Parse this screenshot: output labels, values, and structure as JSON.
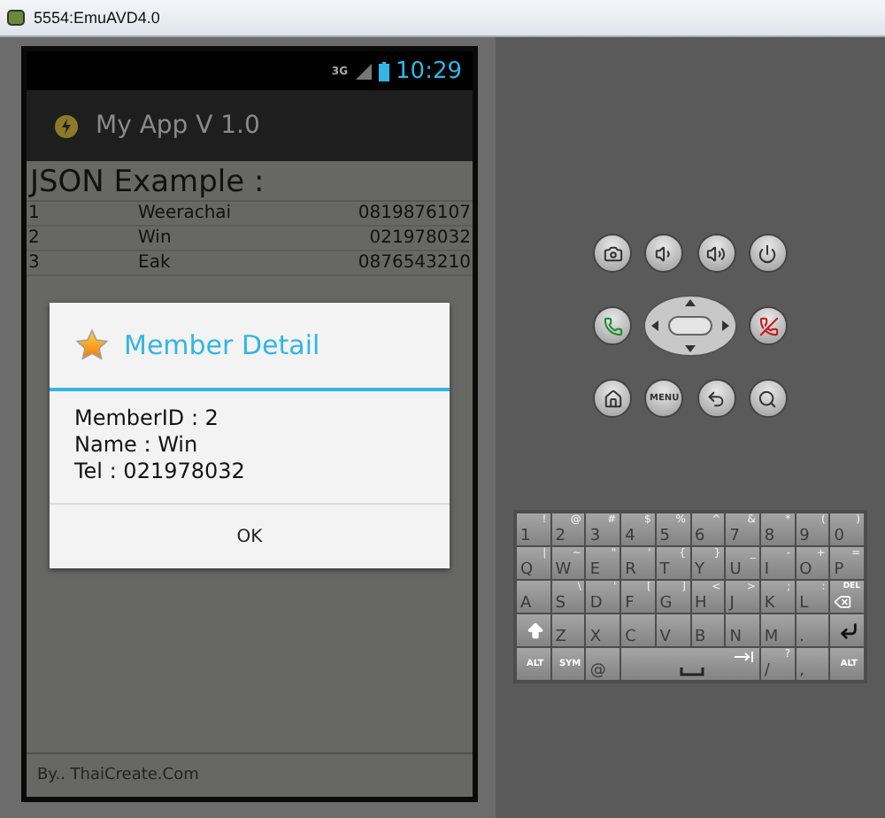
{
  "window": {
    "title": "5554:EmuAVD4.0"
  },
  "status_bar": {
    "network": "3G",
    "time": "10:29"
  },
  "action_bar": {
    "title": "My App V 1.0"
  },
  "heading": "JSON Example :",
  "rows": [
    {
      "id": "1",
      "name": "Weerachai",
      "tel": "0819876107"
    },
    {
      "id": "2",
      "name": "Win",
      "tel": "021978032"
    },
    {
      "id": "3",
      "name": "Eak",
      "tel": "0876543210"
    }
  ],
  "dialog": {
    "title": "Member Detail",
    "lines": [
      "MemberID : 2",
      "Name : Win",
      "Tel : 021978032"
    ],
    "button": "OK"
  },
  "footer": "By.. ThaiCreate.Com",
  "hardware_buttons": [
    [
      {
        "kind": "camera"
      },
      {
        "kind": "volume-down"
      },
      {
        "kind": "volume-up"
      },
      {
        "kind": "power"
      }
    ],
    [
      {
        "kind": "call"
      },
      {
        "kind": "dpad"
      },
      {
        "kind": "end-call"
      }
    ],
    [
      {
        "kind": "home"
      },
      {
        "kind": "menu",
        "label": "MENU"
      },
      {
        "kind": "back"
      },
      {
        "kind": "search"
      }
    ]
  ],
  "keyboard": [
    [
      {
        "kind": "char",
        "label": "1",
        "alt": "!"
      },
      {
        "kind": "char",
        "label": "2",
        "alt": "@"
      },
      {
        "kind": "char",
        "label": "3",
        "alt": "#"
      },
      {
        "kind": "char",
        "label": "4",
        "alt": "$"
      },
      {
        "kind": "char",
        "label": "5",
        "alt": "%"
      },
      {
        "kind": "char",
        "label": "6",
        "alt": "^"
      },
      {
        "kind": "char",
        "label": "7",
        "alt": "&"
      },
      {
        "kind": "char",
        "label": "8",
        "alt": "*"
      },
      {
        "kind": "char",
        "label": "9",
        "alt": "("
      },
      {
        "kind": "char",
        "label": "0",
        "alt": ")"
      }
    ],
    [
      {
        "kind": "char",
        "label": "Q",
        "alt": "|"
      },
      {
        "kind": "char",
        "label": "W",
        "alt": "~"
      },
      {
        "kind": "char",
        "label": "E",
        "alt": "\""
      },
      {
        "kind": "char",
        "label": "R",
        "alt": "'"
      },
      {
        "kind": "char",
        "label": "T",
        "alt": "{"
      },
      {
        "kind": "char",
        "label": "Y",
        "alt": "}"
      },
      {
        "kind": "char",
        "label": "U",
        "alt": "_"
      },
      {
        "kind": "char",
        "label": "I",
        "alt": "-"
      },
      {
        "kind": "char",
        "label": "O",
        "alt": "+"
      },
      {
        "kind": "char",
        "label": "P",
        "alt": "="
      }
    ],
    [
      {
        "kind": "char",
        "label": "A"
      },
      {
        "kind": "char",
        "label": "S",
        "alt": "\\"
      },
      {
        "kind": "char",
        "label": "D",
        "alt": "'"
      },
      {
        "kind": "char",
        "label": "F",
        "alt": "["
      },
      {
        "kind": "char",
        "label": "G",
        "alt": "]"
      },
      {
        "kind": "char",
        "label": "H",
        "alt": "<"
      },
      {
        "kind": "char",
        "label": "J",
        "alt": ">"
      },
      {
        "kind": "char",
        "label": "K",
        "alt": ";"
      },
      {
        "kind": "char",
        "label": "L",
        "alt": ":"
      },
      {
        "kind": "del",
        "label": "DEL"
      }
    ],
    [
      {
        "kind": "shift"
      },
      {
        "kind": "char",
        "label": "Z"
      },
      {
        "kind": "char",
        "label": "X"
      },
      {
        "kind": "char",
        "label": "C"
      },
      {
        "kind": "char",
        "label": "V"
      },
      {
        "kind": "char",
        "label": "B"
      },
      {
        "kind": "char",
        "label": "N"
      },
      {
        "kind": "char",
        "label": "M"
      },
      {
        "kind": "char",
        "label": "."
      },
      {
        "kind": "enter"
      }
    ],
    [
      {
        "kind": "mod",
        "label": "ALT"
      },
      {
        "kind": "mod",
        "label": "SYM"
      },
      {
        "kind": "char",
        "label": "@"
      },
      {
        "kind": "space"
      },
      {
        "kind": "char",
        "label": "/",
        "alt": "?"
      },
      {
        "kind": "char",
        "label": ","
      },
      {
        "kind": "mod",
        "label": "ALT"
      }
    ]
  ]
}
